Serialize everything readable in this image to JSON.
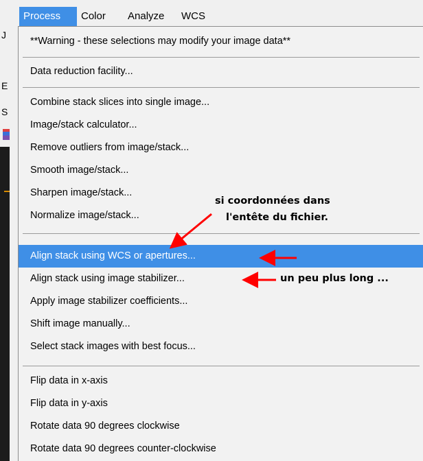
{
  "menubar": {
    "items": [
      "Process",
      "Color",
      "Analyze",
      "WCS"
    ]
  },
  "background_window": {
    "visible_chars": [
      "J",
      "E",
      "S"
    ]
  },
  "process_menu": {
    "items": [
      "**Warning - these selections may modify your image data**",
      "Data reduction facility...",
      "Combine stack slices into single image...",
      "Image/stack calculator...",
      "Remove outliers from image/stack...",
      "Smooth image/stack...",
      "Sharpen image/stack...",
      "Normalize image/stack...",
      "Align stack using WCS or apertures...",
      "Align stack using image stabilizer...",
      "Apply image stabilizer coefficients...",
      "Shift image manually...",
      "Select stack images with best focus...",
      "Flip data in x-axis",
      "Flip data in y-axis",
      "Rotate data 90 degrees clockwise",
      "Rotate data 90 degrees counter-clockwise"
    ],
    "highlighted_item": "Align stack using WCS or apertures..."
  },
  "annotations": {
    "note_line1": "si coordonnées dans",
    "note_line2": "l'entête du fichier.",
    "note_stabilizer": "un peu plus long ...",
    "arrow_color": "#ff0000"
  },
  "colors": {
    "highlight": "#3f8fe6",
    "menu_bg": "#f2f2f2"
  }
}
